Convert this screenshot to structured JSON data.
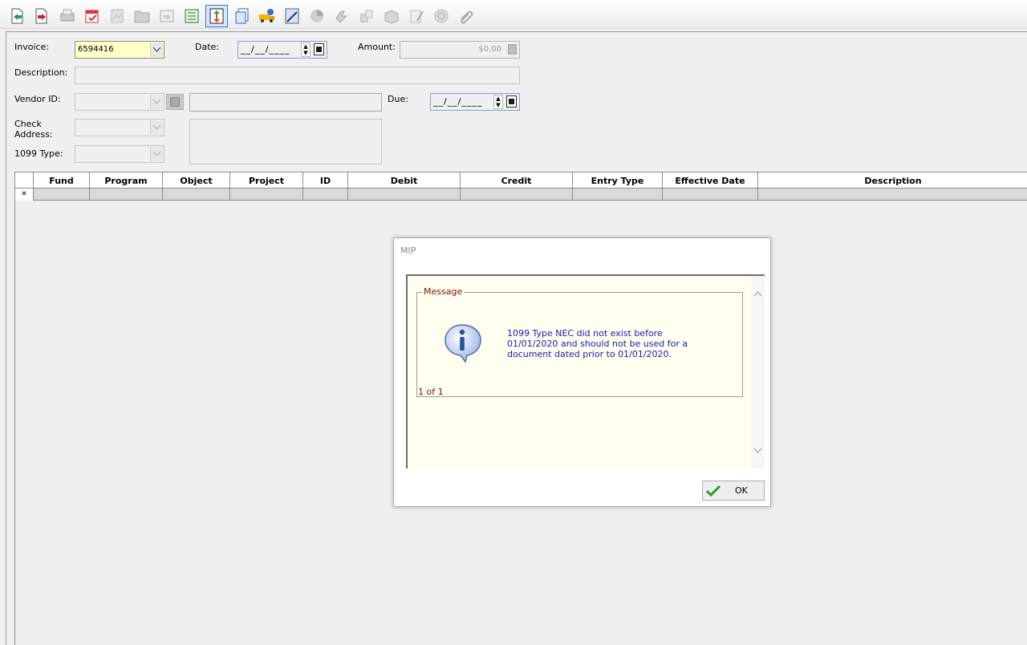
{
  "toolbar": {
    "icons": [
      "new-document-icon",
      "delete-document-icon",
      "print-icon",
      "calendar-check-icon",
      "report-icon",
      "folder-icon",
      "year-icon",
      "list-icon",
      "import-export-icon",
      "copy-document-icon",
      "truck-info-icon",
      "calculator-icon",
      "pie-chart-icon",
      "refresh-icon",
      "reverse-icon",
      "distribute-icon",
      "note-icon",
      "attachment-icon",
      "paperclip-icon"
    ]
  },
  "form": {
    "invoice_label": "Invoice:",
    "invoice_value": "6594416",
    "date_label": "Date:",
    "date_value": "__/__/____",
    "amount_label": "Amount:",
    "amount_value": "$0.00",
    "description_label": "Description:",
    "vendor_label": "Vendor ID:",
    "due_label": "Due:",
    "due_value": "__/__/____",
    "check_address_label_1": "Check",
    "check_address_label_2": "Address:",
    "type1099_label": "1099 Type:"
  },
  "grid": {
    "columns": [
      "Fund",
      "Program",
      "Object",
      "Project",
      "ID",
      "Debit",
      "Credit",
      "Entry Type",
      "Effective Date",
      "Description"
    ],
    "new_row_marker": "*"
  },
  "dialog": {
    "title": "MIP",
    "group_label": "Message",
    "message": "1099 Type NEC did not exist before 01/01/2020 and should not be used for a document dated prior to 01/01/2020.",
    "counter": "1 of 1",
    "ok_label": "OK"
  }
}
